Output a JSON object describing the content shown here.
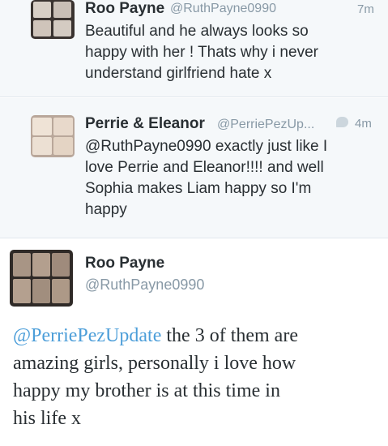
{
  "tweets": [
    {
      "name": "Roo Payne",
      "handle": "@RuthPayne0990",
      "time": "7m",
      "lines": [
        "Beautiful and he always looks so",
        "happy with her ! Thats why i never",
        "understand girlfriend hate x"
      ]
    },
    {
      "name": "Perrie & Eleanor",
      "handle": "@PerriePezUp...",
      "time": "4m",
      "lines": [
        "@RuthPayne0990 exactly just like I",
        "love Perrie and Eleanor!!!! and well",
        "Sophia makes Liam happy so I'm",
        "happy"
      ]
    }
  ],
  "detail": {
    "name": "Roo Payne",
    "handle": "@RuthPayne0990",
    "mention": "@PerriePezUpdate",
    "line1_rest": " the 3 of them are",
    "lines": [
      "amazing girls, personally i love how",
      "happy my brother is at this time in",
      "his life x"
    ]
  }
}
